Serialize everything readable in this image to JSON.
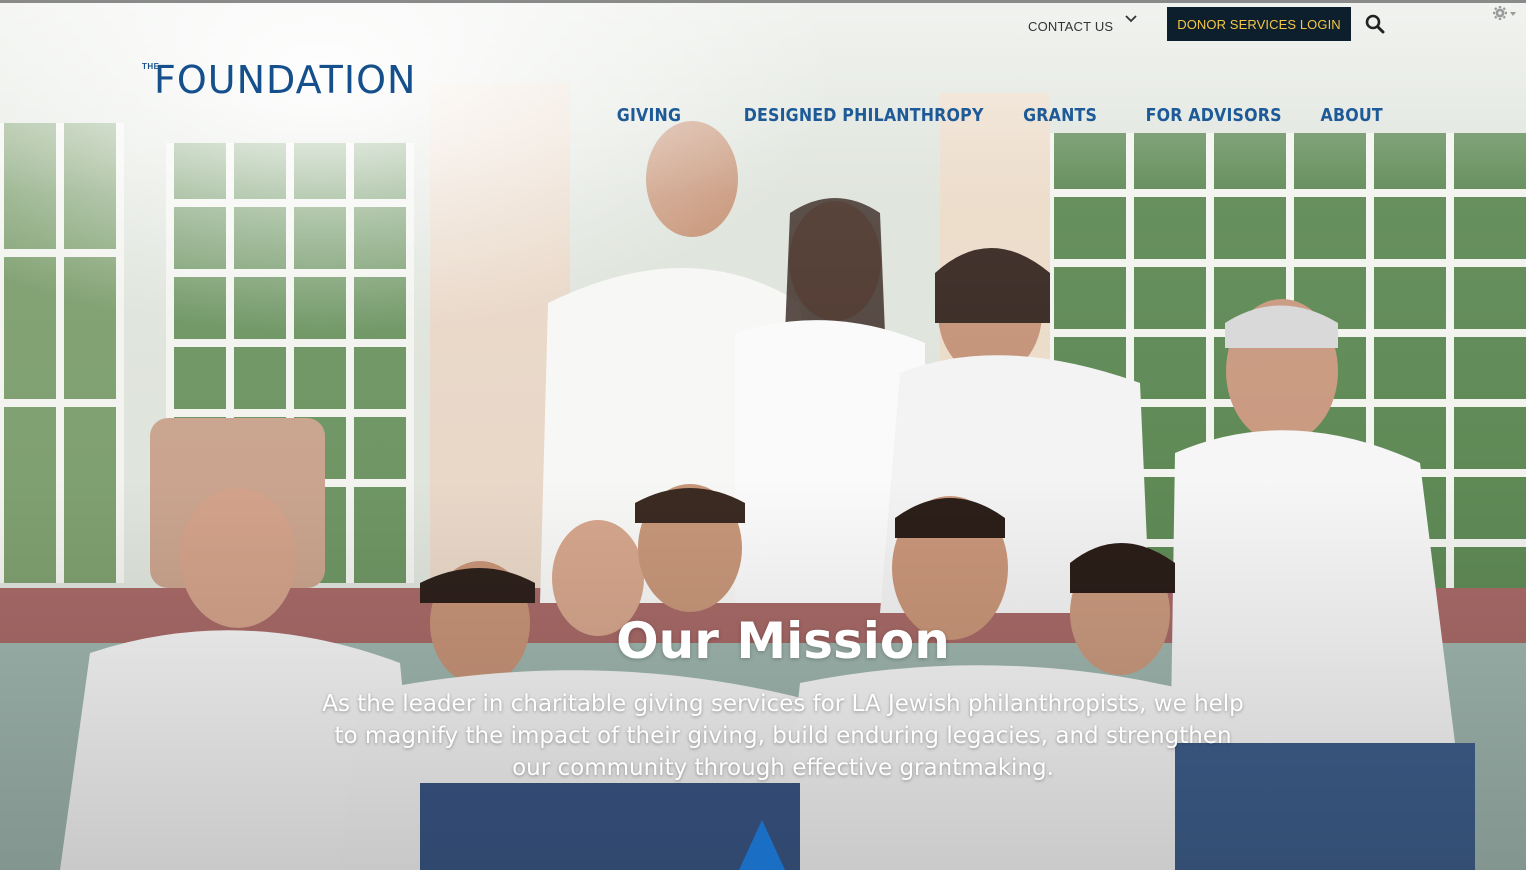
{
  "header": {
    "contact_label": "CONTACT US",
    "donor_login_label": "DONOR SERVICES LOGIN",
    "icons": [
      "chevron-down-icon",
      "search-icon",
      "gear-icon",
      "caret-down-icon"
    ]
  },
  "logo": {
    "prefix": "THE",
    "wordmark": "FOUNDATION"
  },
  "nav": {
    "items": [
      {
        "label": "GIVING"
      },
      {
        "label": "DESIGNED PHILANTHROPY"
      },
      {
        "label": "GRANTS"
      },
      {
        "label": "FOR ADVISORS"
      },
      {
        "label": "ABOUT"
      }
    ]
  },
  "hero": {
    "title": "Our Mission",
    "text": "As the leader in charitable giving services for LA Jewish philanthropists, we help to magnify the impact of their giving, build enduring legacies, and strengthen our community through effective grantmaking."
  },
  "colors": {
    "brand_blue": "#154f8c",
    "nav_blue": "#1d5a97",
    "login_bg": "#0d1f2d",
    "login_text": "#f2c744",
    "accent_triangle": "#1a6fc4"
  }
}
